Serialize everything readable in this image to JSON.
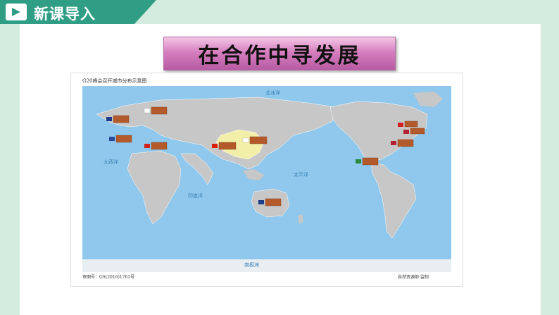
{
  "header": {
    "section_label": "新课导入"
  },
  "slide": {
    "title": "在合作中寻发展"
  },
  "map": {
    "title": "G20峰会召开城市分布示意图",
    "approval_number": "审图号：GS(2016)1761号",
    "credit": "自然资源部  监制",
    "ocean_labels": [
      "北冰洋",
      "太平洋",
      "大西洋",
      "印度洋",
      "南极洲"
    ],
    "colors": {
      "ocean": "#8fc8ec",
      "land": "#c7c7c7",
      "china": "#f2f0a8",
      "border": "#ffffff",
      "tag": "#b45a2a"
    }
  }
}
